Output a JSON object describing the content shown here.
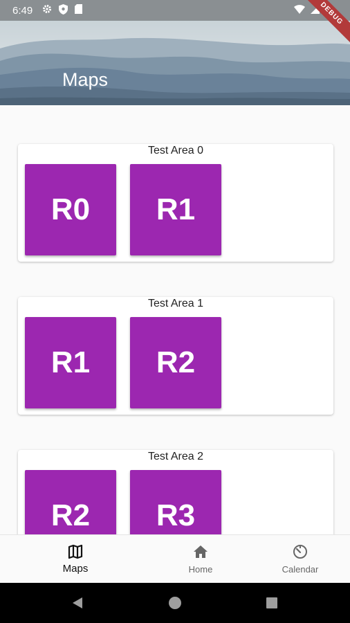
{
  "status_bar": {
    "time": "6:49",
    "icons": [
      "settings-icon",
      "shield-icon",
      "sd-card-icon"
    ],
    "right_icons": [
      "wifi-icon",
      "signal-icon",
      "battery-icon"
    ]
  },
  "debug_banner": "DEBUG",
  "app_bar": {
    "title": "Maps"
  },
  "cards": [
    {
      "title": "Test Area 0",
      "tiles": [
        "R0",
        "R1"
      ]
    },
    {
      "title": "Test Area 1",
      "tiles": [
        "R1",
        "R2"
      ]
    },
    {
      "title": "Test Area 2",
      "tiles": [
        "R2",
        "R3"
      ]
    }
  ],
  "bottom_nav": {
    "items": [
      {
        "label": "Maps",
        "icon": "map-icon",
        "active": true
      },
      {
        "label": "Home",
        "icon": "home-icon",
        "active": false
      },
      {
        "label": "Calendar",
        "icon": "timer-icon",
        "active": false
      }
    ]
  },
  "colors": {
    "tile": "#9c27b0",
    "debug_banner": "#b23a3a"
  }
}
